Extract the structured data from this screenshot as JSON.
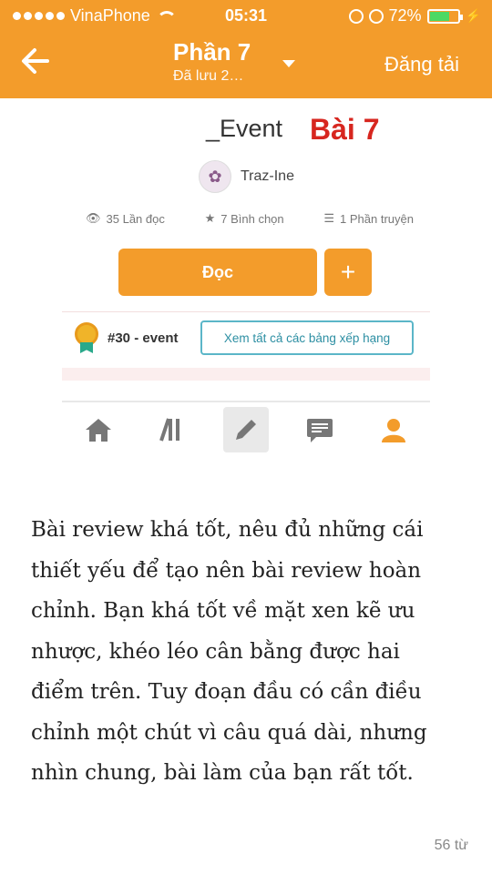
{
  "status_bar": {
    "carrier": "VinaPhone",
    "time": "05:31",
    "battery": "72%",
    "battery_level": 0.72
  },
  "header": {
    "title": "Phần 7",
    "subtitle": "Đã lưu 2…",
    "upload_label": "Đăng tải"
  },
  "embedded": {
    "story_title": "_Event",
    "red_label": "Bài 7",
    "author": "Traz-Ine",
    "stats": {
      "reads": "35 Lần đọc",
      "votes": "7 Bình chọn",
      "parts": "1 Phần truyện"
    },
    "read_button": "Đọc",
    "plus_button": "+",
    "rank": "#30 - event",
    "ranks_button": "Xem tất cả các bảng xếp hạng"
  },
  "review": {
    "lines": [
      "Bài review khá tốt, nêu đủ những cái",
      "thiết yếu để tạo nên bài review hoàn",
      "chỉnh. Bạn khá tốt về mặt xen kẽ ưu",
      "nhược, khéo léo cân bằng được hai",
      "điểm trên. Tuy đoạn đầu có cần điều",
      "chỉnh một chút vì câu quá dài, nhưng",
      "nhìn chung, bài làm của bạn rất tốt."
    ],
    "word_count": "56 từ"
  },
  "colors": {
    "accent": "#f39c2b",
    "red_label": "#d7261f",
    "link_border": "#5bb6c8"
  },
  "icons": [
    "back-arrow-icon",
    "dropdown-caret-icon",
    "eye-icon",
    "star-icon",
    "list-icon",
    "medal-icon",
    "home-icon",
    "library-icon",
    "pencil-icon",
    "chat-icon",
    "profile-icon"
  ]
}
